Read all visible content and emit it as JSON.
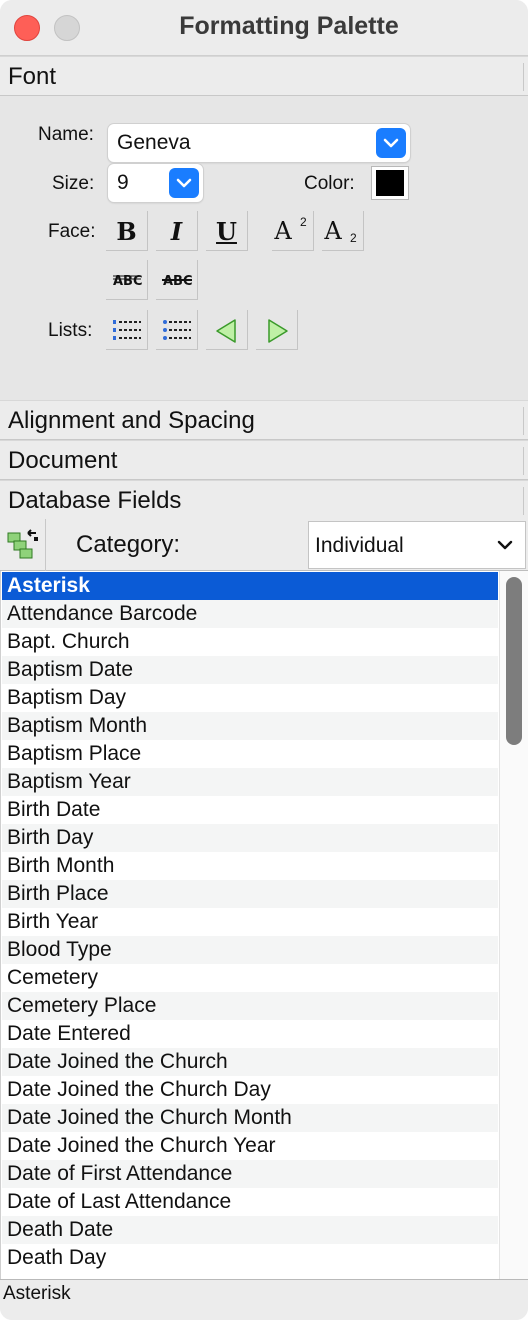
{
  "window": {
    "title": "Formatting Palette"
  },
  "sections": {
    "font": "Font",
    "alignment": "Alignment and Spacing",
    "document": "Document",
    "database": "Database Fields"
  },
  "font": {
    "name_label": "Name:",
    "name_value": "Geneva",
    "size_label": "Size:",
    "size_value": "9",
    "color_label": "Color:",
    "color_value": "#000000",
    "face_label": "Face:",
    "lists_label": "Lists:",
    "face_buttons": {
      "bold": "B",
      "italic": "I",
      "underline": "U",
      "superscript": "A",
      "superscript_mark": "2",
      "subscript": "A",
      "subscript_mark": "2"
    }
  },
  "database": {
    "category_label": "Category:",
    "category_value": "Individual",
    "selected_index": 0,
    "items": [
      "Asterisk",
      "Attendance Barcode",
      "Bapt. Church",
      "Baptism Date",
      "Baptism Day",
      "Baptism Month",
      "Baptism Place",
      "Baptism Year",
      "Birth Date",
      "Birth Day",
      "Birth Month",
      "Birth Place",
      "Birth Year",
      "Blood Type",
      "Cemetery",
      "Cemetery Place",
      "Date Entered",
      "Date Joined the Church",
      "Date Joined the Church Day",
      "Date Joined the Church Month",
      "Date Joined the Church Year",
      "Date of First Attendance",
      "Date of Last Attendance",
      "Death Date",
      "Death Day"
    ]
  },
  "status": {
    "text": "Asterisk"
  },
  "colors": {
    "accent": "#1a7dff",
    "selection": "#0b5bd6",
    "close": "#fe5f57"
  }
}
